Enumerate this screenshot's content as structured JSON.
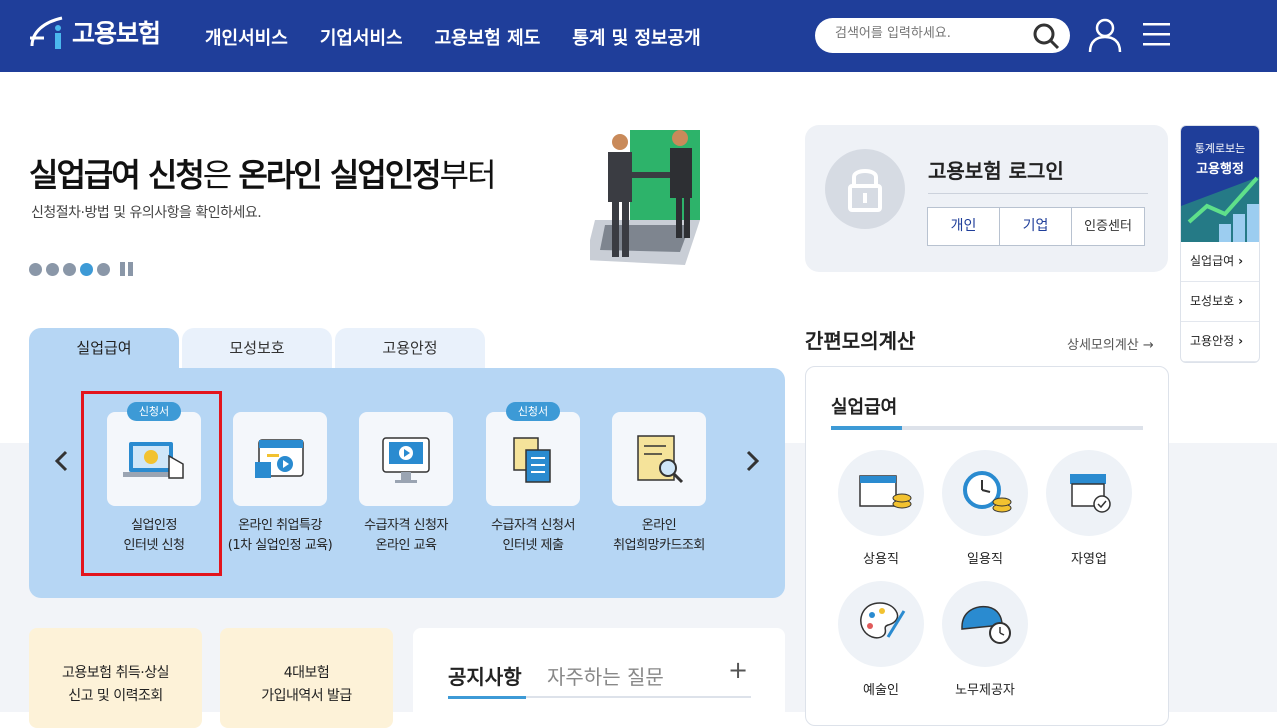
{
  "header": {
    "logo_text": "고용보험",
    "nav": [
      "개인서비스",
      "기업서비스",
      "고용보험 제도",
      "통계 및 정보공개"
    ],
    "search_placeholder": "검색어를 입력하세요."
  },
  "hero": {
    "title_bold_1": "실업급여 신청",
    "title_light_1": "은 ",
    "title_bold_2": "온라인 실업인정",
    "title_light_2": "부터",
    "subtitle": "신청절차·방법 및 유의사항을 확인하세요."
  },
  "login": {
    "title": "고용보험 로그인",
    "buttons": [
      "개인",
      "기업",
      "인증센터"
    ]
  },
  "stat_panel": {
    "line1": "통계로보는",
    "line2": "고용행정",
    "items": [
      "실업급여",
      "모성보호",
      "고용안정"
    ]
  },
  "service_tabs": [
    "실업급여",
    "모성보호",
    "고용안정"
  ],
  "services": [
    {
      "badge": "신청서",
      "label": "실업인정\n인터넷 신청"
    },
    {
      "badge": "",
      "label": "온라인 취업특강\n(1차 실업인정 교육)"
    },
    {
      "badge": "",
      "label": "수급자격 신청자\n온라인 교육"
    },
    {
      "badge": "신청서",
      "label": "수급자격 신청서\n인터넷 제출"
    },
    {
      "badge": "",
      "label": "온라인\n취업희망카드조회"
    }
  ],
  "calculator": {
    "title": "간편모의계산",
    "link": "상세모의계산",
    "head": "실업급여",
    "items": [
      "상용직",
      "일용직",
      "자영업",
      "예술인",
      "노무제공자"
    ]
  },
  "quick_links": [
    {
      "label": "고용보험 취득·상실\n신고 및 이력조회"
    },
    {
      "label": "4대보험\n가입내역서 발급"
    }
  ],
  "notice": {
    "tab1": "공지사항",
    "tab2": "자주하는 질문",
    "plus": "+"
  },
  "colors": {
    "brand": "#1f3e9a",
    "accent": "#3d9ad6",
    "highlight": "#e3141c"
  }
}
